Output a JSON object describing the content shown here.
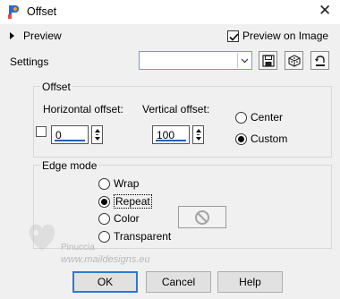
{
  "window": {
    "title": "Offset",
    "icon": "paint-shop-pro-icon",
    "close_glyph": "✕"
  },
  "preview": {
    "expander_label": "Preview",
    "preview_on_image_label": "Preview on Image",
    "preview_on_image_checked": true
  },
  "settings": {
    "label": "Settings",
    "preset_value": "",
    "tools": [
      "save-preset-icon",
      "randomize-icon",
      "reset-icon"
    ]
  },
  "offset": {
    "group_label": "Offset",
    "horizontal_label": "Horizontal offset:",
    "vertical_label": "Vertical offset:",
    "horizontal_value": "0",
    "vertical_value": "100",
    "lock_checked": false,
    "center_label": "Center",
    "custom_label": "Custom",
    "selected": "Custom"
  },
  "edge_mode": {
    "group_label": "Edge mode",
    "wrap_label": "Wrap",
    "repeat_label": "Repeat",
    "color_label": "Color",
    "transparent_label": "Transparent",
    "selected": "Repeat",
    "color_swatch_icon": "no-color-icon"
  },
  "watermark": {
    "line1": "Pinuccia",
    "line2": "www.maildesigns.eu"
  },
  "buttons": {
    "ok": "OK",
    "cancel": "Cancel",
    "help": "Help"
  },
  "colors": {
    "accent_blue": "#1e5fc0",
    "default_button_border": "#2a7ad1",
    "window_bg": "#f0f0f0"
  }
}
